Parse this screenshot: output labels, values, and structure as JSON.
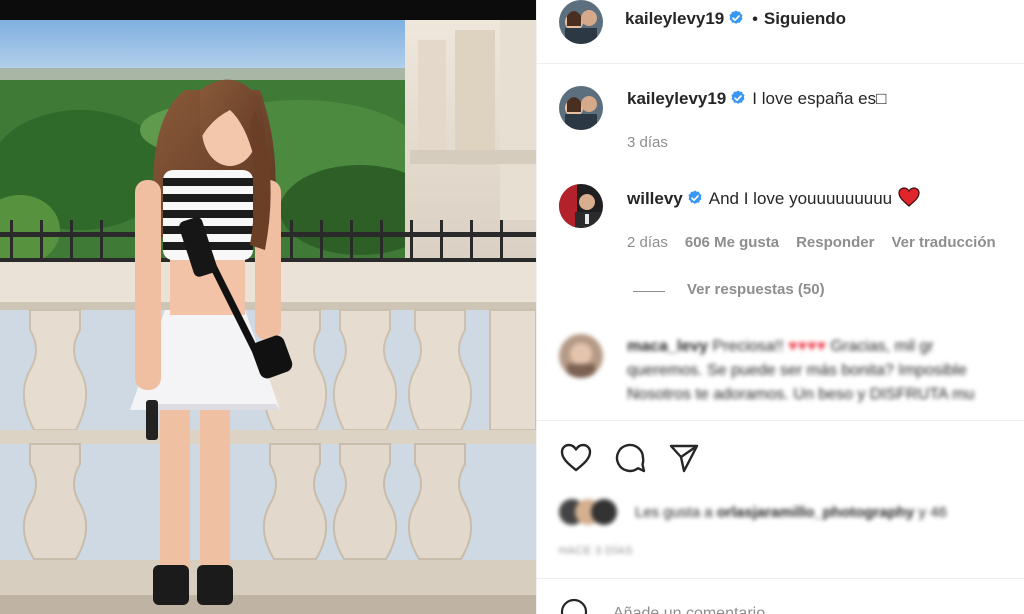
{
  "post": {
    "author": "kaileylevy19",
    "follow_status": "Siguiendo",
    "separator": "•"
  },
  "caption": {
    "username": "kaileylevy19",
    "text": "I love españa es□",
    "time": "3 días"
  },
  "comment": {
    "username": "willevy",
    "text": "And I love youuuuuuuuu",
    "time": "2 días",
    "likes": "606 Me gusta",
    "reply_label": "Responder",
    "translate_label": "Ver traducción",
    "view_replies": "Ver respuestas (50)"
  },
  "blurred_comment": {
    "username": "maca_levy",
    "line1": "Preciosa!!",
    "line1_rest": "Gracias, mil gr",
    "line2": "queremos. Se puede ser más bonita? Imposible",
    "line3": "Nosotros te adoramos. Un beso y DISFRUTA mu"
  },
  "likes_line": {
    "prefix": "Les gusta a",
    "user": "orlasjaramillo_photography",
    "suffix": "y 46"
  },
  "post_time": "HACE 3 DÍAS",
  "add_comment_placeholder": "Añade un comentario...",
  "colors": {
    "verified": "#3897f0",
    "heart": "#ed4956",
    "muted": "#8e8e8e",
    "text": "#262626"
  },
  "icons": [
    "verified-badge-icon",
    "heart-outline-icon",
    "comment-icon",
    "share-icon",
    "heart-emoji-icon",
    "emoji-icon"
  ]
}
